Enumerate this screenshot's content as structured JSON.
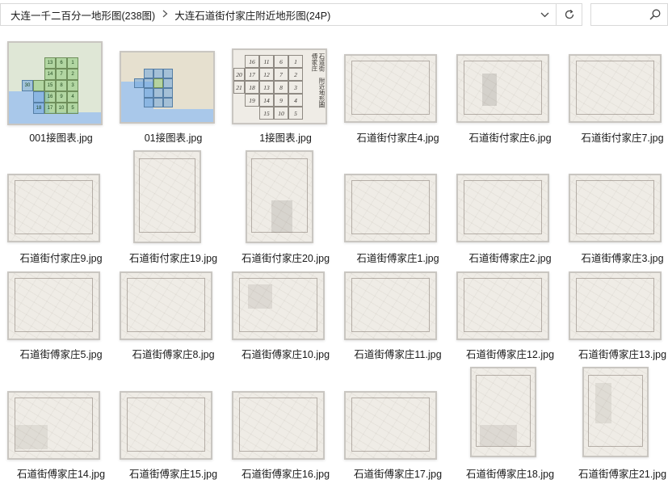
{
  "address": {
    "crumbs": [
      "大连一千二百分一地形图(238图)",
      "大连石道街付家庄附近地形图(24P)"
    ]
  },
  "search": {
    "placeholder": ""
  },
  "files": [
    {
      "name": "001接图表.jpg"
    },
    {
      "name": "01接图表.jpg"
    },
    {
      "name": "1接图表.jpg"
    },
    {
      "name": "石道街付家庄4.jpg"
    },
    {
      "name": "石道街付家庄6.jpg"
    },
    {
      "name": "石道街付家庄7.jpg"
    },
    {
      "name": "石道街付家庄9.jpg"
    },
    {
      "name": "石道街付家庄19.jpg"
    },
    {
      "name": "石道街付家庄20.jpg"
    },
    {
      "name": "石道街傅家庄1.jpg"
    },
    {
      "name": "石道街傅家庄2.jpg"
    },
    {
      "name": "石道街傅家庄3.jpg"
    },
    {
      "name": "石道街傅家庄5.jpg"
    },
    {
      "name": "石道街傅家庄8.jpg"
    },
    {
      "name": "石道街傅家庄10.jpg"
    },
    {
      "name": "石道街傅家庄11.jpg"
    },
    {
      "name": "石道街傅家庄12.jpg"
    },
    {
      "name": "石道街傅家庄13.jpg"
    },
    {
      "name": "石道街傅家庄14.jpg"
    },
    {
      "name": "石道街傅家庄15.jpg"
    },
    {
      "name": "石道街傅家庄16.jpg"
    },
    {
      "name": "石道街傅家庄17.jpg"
    },
    {
      "name": "石道街傅家庄18.jpg"
    },
    {
      "name": "石道街傅家庄21.jpg"
    }
  ],
  "index_sheet": {
    "title_col1": "石道街",
    "title_col2": "傅家庄",
    "title_col3": "附近地形圖",
    "numbers": [
      "16",
      "11",
      "6",
      "1",
      "20",
      "17",
      "12",
      "7",
      "2",
      "21",
      "18",
      "13",
      "8",
      "3",
      "19",
      "14",
      "9",
      "4",
      "15",
      "10",
      "5"
    ]
  },
  "index_map_numbers": [
    "13",
    "6",
    "1",
    "14",
    "7",
    "2",
    "30",
    "15",
    "8",
    "3",
    "16",
    "9",
    "4",
    "18",
    "17",
    "10",
    "5",
    "15"
  ]
}
